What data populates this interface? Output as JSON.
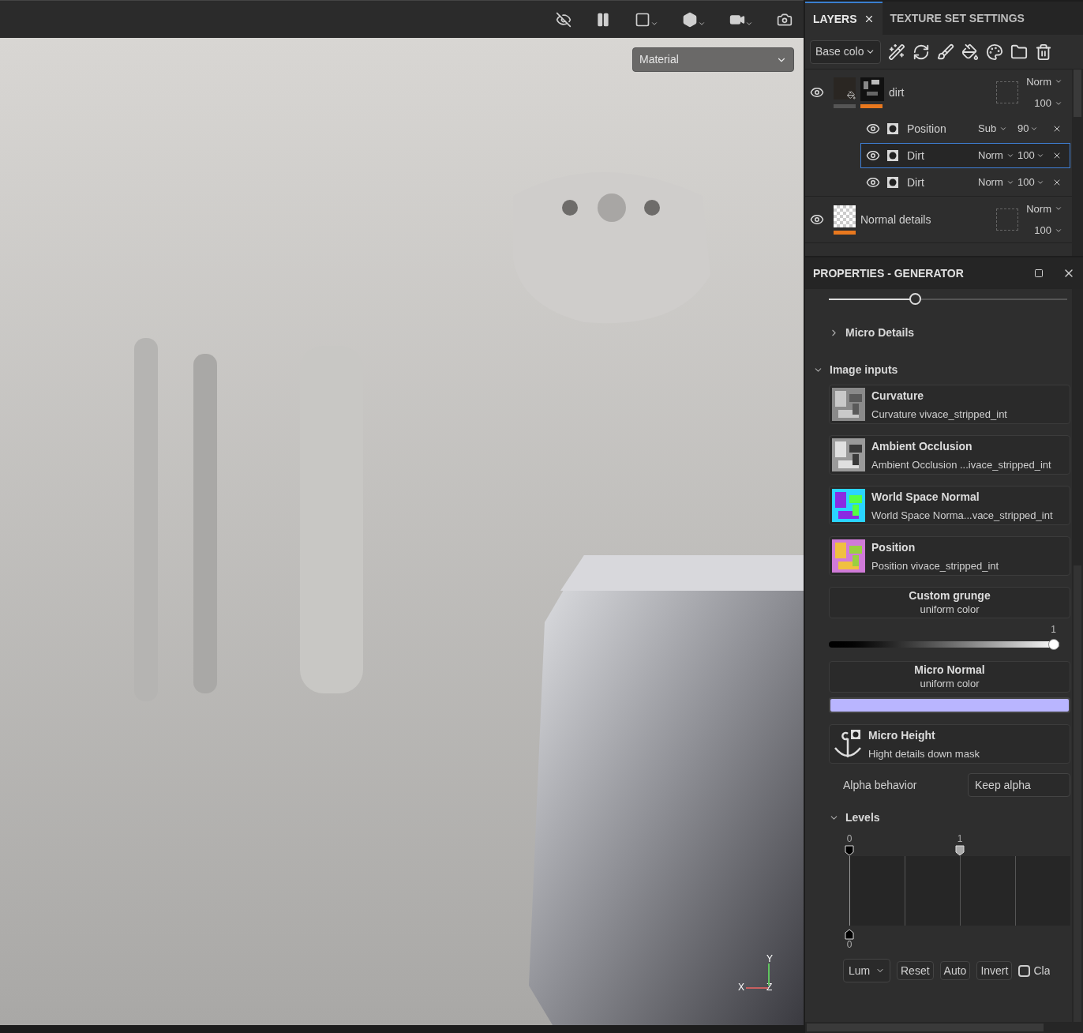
{
  "viewport": {
    "shading_mode": "Material",
    "axes": {
      "x": "X",
      "y": "Y",
      "z": "Z"
    }
  },
  "layers_panel": {
    "tabs": [
      {
        "label": "LAYERS",
        "selected": true,
        "closable": true
      },
      {
        "label": "TEXTURE SET SETTINGS",
        "selected": false,
        "closable": false
      }
    ],
    "channel": "Base colo",
    "layers": [
      {
        "name": "dirt",
        "visible": true,
        "kind": "fill",
        "blend": "Norm",
        "opacity": "100",
        "effects": [
          {
            "name": "Position",
            "visible": true,
            "blend": "Sub",
            "opacity": "90",
            "selected": false
          },
          {
            "name": "Dirt",
            "visible": true,
            "blend": "Norm",
            "opacity": "100",
            "selected": true
          },
          {
            "name": "Dirt",
            "visible": true,
            "blend": "Norm",
            "opacity": "100",
            "selected": false
          }
        ]
      },
      {
        "name": "Normal details",
        "visible": true,
        "kind": "paint",
        "blend": "Norm",
        "opacity": "100"
      }
    ]
  },
  "properties": {
    "title": "PROPERTIES - GENERATOR",
    "top_slider": {
      "level": 0.36
    },
    "micro_details": {
      "label": "Micro Details",
      "expanded": false
    },
    "image_inputs": {
      "label": "Image inputs",
      "expanded": true,
      "items": [
        {
          "kind": "texture",
          "title": "Curvature",
          "subtitle": "Curvature vivace_stripped_int"
        },
        {
          "kind": "texture",
          "title": "Ambient Occlusion",
          "subtitle": "Ambient Occlusion ...ivace_stripped_int"
        },
        {
          "kind": "texture",
          "title": "World Space Normal",
          "subtitle": "World Space Norma...vace_stripped_int"
        },
        {
          "kind": "texture",
          "title": "Position",
          "subtitle": "Position vivace_stripped_int"
        },
        {
          "kind": "uniform",
          "title": "Custom grunge",
          "subtitle": "uniform color",
          "reading": "1",
          "level": 1
        },
        {
          "kind": "uniform",
          "title": "Micro Normal",
          "subtitle": "uniform color",
          "color": "#b9b5ff"
        },
        {
          "kind": "anchor",
          "title": "Micro Height",
          "subtitle": "Hight details down mask"
        }
      ]
    },
    "alpha_behavior": {
      "label": "Alpha behavior",
      "value": "Keep alpha"
    },
    "levels": {
      "label": "Levels",
      "expanded": true,
      "input_low": {
        "reading": "0",
        "level": 0
      },
      "input_high": {
        "reading": "1",
        "level": 0.5
      },
      "output_low": {
        "reading": "0"
      },
      "channel": "Lum",
      "buttons": [
        "Reset",
        "Auto",
        "Invert"
      ],
      "clamp": {
        "label": "Cla",
        "checked": false
      }
    }
  }
}
